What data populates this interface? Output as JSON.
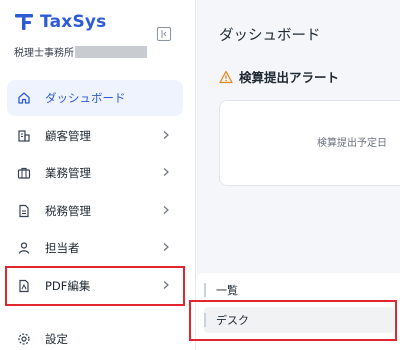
{
  "brand": {
    "name": "TaxSys",
    "color": "#2d5bd6"
  },
  "office_label": "税理士事務所",
  "nav": {
    "items": [
      {
        "label": "ダッシュボード",
        "icon": "home-icon",
        "active": true
      },
      {
        "label": "顧客管理",
        "icon": "building-icon"
      },
      {
        "label": "業務管理",
        "icon": "briefcase-icon"
      },
      {
        "label": "税務管理",
        "icon": "document-icon"
      },
      {
        "label": "担当者",
        "icon": "person-icon"
      },
      {
        "label": "PDF編集",
        "icon": "pdf-file-icon",
        "highlighted": true
      }
    ],
    "settings_label": "設定"
  },
  "main": {
    "title": "ダッシュボード",
    "alert_title": "検算提出アラート",
    "alert_empty": "検算提出予定日"
  },
  "submenu": {
    "items": [
      {
        "label": "一覧"
      },
      {
        "label": "デスク",
        "highlighted": true
      }
    ]
  },
  "colors": {
    "accent": "#2d5bd6",
    "active_bg": "#eef3fd",
    "highlight_red": "#e0262f",
    "warning": "#e8871e"
  }
}
